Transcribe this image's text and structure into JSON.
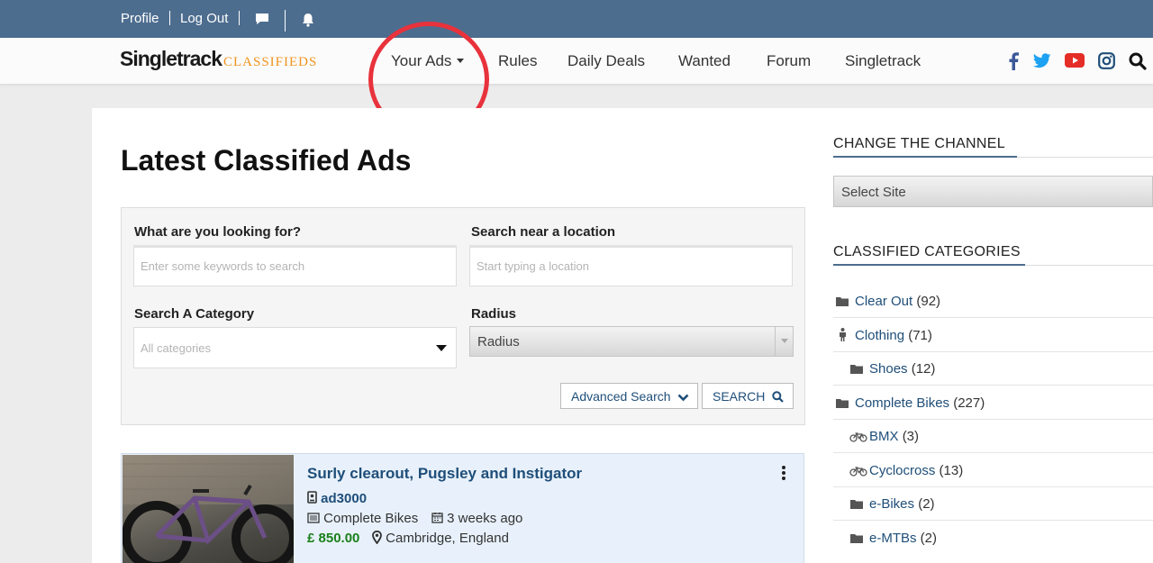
{
  "topbar": {
    "profile": "Profile",
    "logout": "Log Out",
    "icons": [
      "chat-icon",
      "bell-icon"
    ]
  },
  "logo": {
    "part1": "Singletrack",
    "part2": "CLASSIFIEDS"
  },
  "nav": {
    "items": [
      "Your Ads",
      "Rules",
      "Daily Deals",
      "Wanted",
      "Forum",
      "Singletrack"
    ],
    "social_icons": [
      "facebook-icon",
      "twitter-icon",
      "youtube-icon",
      "instagram-icon",
      "search-icon"
    ]
  },
  "colors": {
    "topbar": "#4d6d8f",
    "link": "#1f4e79",
    "accent": "#f0931d",
    "price": "#1a7f1a",
    "annotation": "#e8323c"
  },
  "main": {
    "title": "Latest Classified Ads",
    "search": {
      "keywords_label": "What are you looking for?",
      "keywords_placeholder": "Enter some keywords to search",
      "location_label": "Search near a location",
      "location_placeholder": "Start typing a location",
      "category_label": "Search A Category",
      "category_value": "All categories",
      "radius_label": "Radius",
      "radius_value": "Radius",
      "advanced_label": "Advanced Search",
      "search_label": "SEARCH"
    },
    "listing": {
      "title": "Surly clearout, Pugsley and Instigator",
      "user": "ad3000",
      "category": "Complete Bikes",
      "time": "3 weeks ago",
      "price": "£ 850.00",
      "location": "Cambridge, England"
    }
  },
  "sidebar": {
    "channel_heading": "CHANGE THE CHANNEL",
    "site_select": "Select Site",
    "categories_heading": "CLASSIFIED CATEGORIES",
    "categories": [
      {
        "name": "Clear Out",
        "count": "(92)",
        "icon": "folder-icon"
      },
      {
        "name": "Clothing",
        "count": "(71)",
        "icon": "person-icon"
      },
      {
        "name": "Shoes",
        "count": "(12)",
        "icon": "folder-icon"
      },
      {
        "name": "Complete Bikes",
        "count": "(227)",
        "icon": "folder-icon"
      },
      {
        "name": "BMX",
        "count": "(3)",
        "icon": "bicycle-icon"
      },
      {
        "name": "Cyclocross",
        "count": "(13)",
        "icon": "bicycle-icon"
      },
      {
        "name": "e-Bikes",
        "count": "(2)",
        "icon": "folder-icon"
      },
      {
        "name": "e-MTBs",
        "count": "(2)",
        "icon": "folder-icon"
      }
    ]
  }
}
